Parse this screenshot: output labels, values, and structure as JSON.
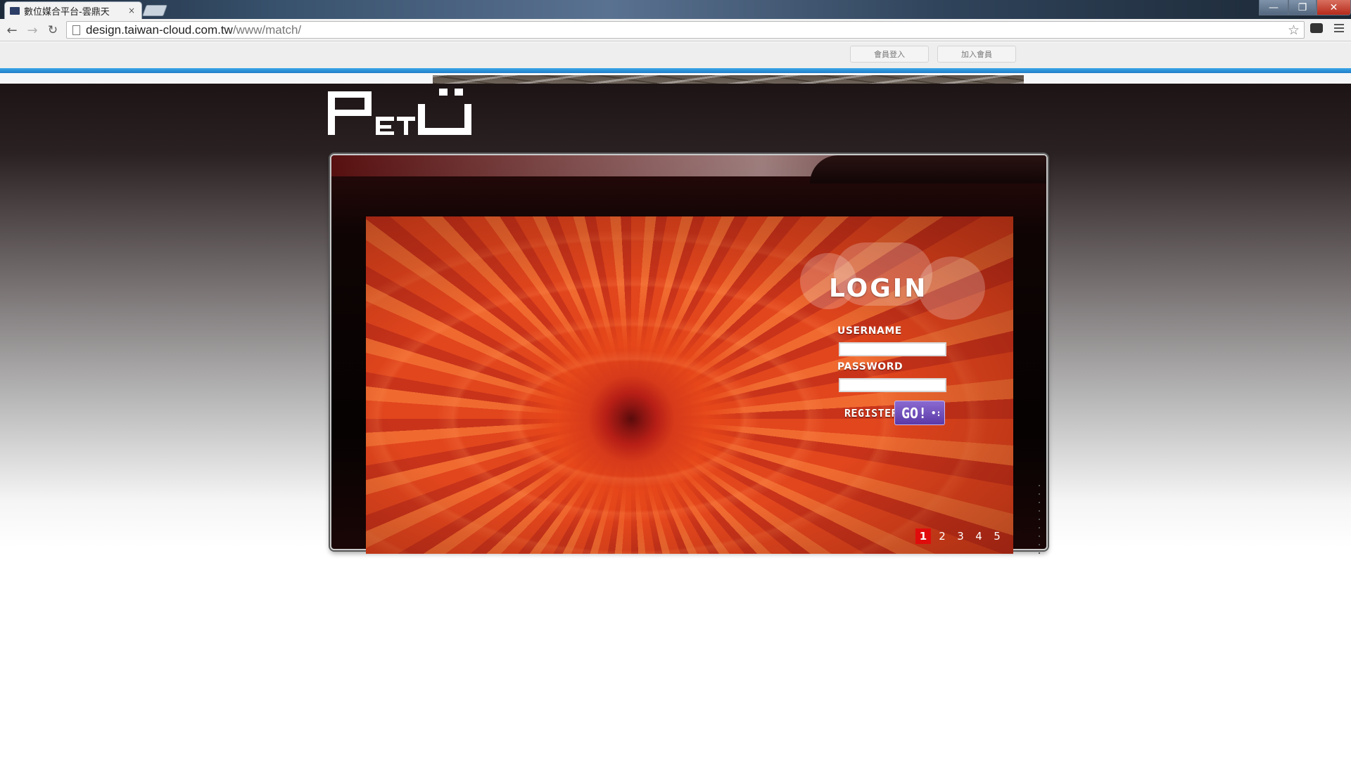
{
  "browser": {
    "tab_title": "數位媒合平台-雲鼎天",
    "tab_close": "×",
    "url_host": "design.taiwan-cloud.com.tw",
    "url_path": "/www/match/",
    "icons": [
      "back-arrow-icon",
      "forward-arrow-icon",
      "reload-icon",
      "page-icon",
      "star-icon",
      "extension-icon",
      "menu-icon"
    ]
  },
  "window_controls": {
    "minimize": "—",
    "maximize": "❐",
    "close": "✕"
  },
  "top_links": {
    "login": "會員登入",
    "join": "加入會員"
  },
  "login": {
    "title": "LOGIN",
    "username_label": "USERNAME",
    "password_label": "PASSWORD",
    "username_value": "",
    "password_value": "",
    "register_label": "REGISTER",
    "go_label": "GO!",
    "go_dots": "•:"
  },
  "slider": {
    "pages": [
      "1",
      "2",
      "3",
      "4",
      "5"
    ],
    "active_page": "1"
  },
  "colors": {
    "accent_blue": "#2a93dc",
    "active_page_red": "#e00c0c",
    "go_button_purple": "#6f4fbf",
    "flower_orange": "#e04a1e"
  }
}
